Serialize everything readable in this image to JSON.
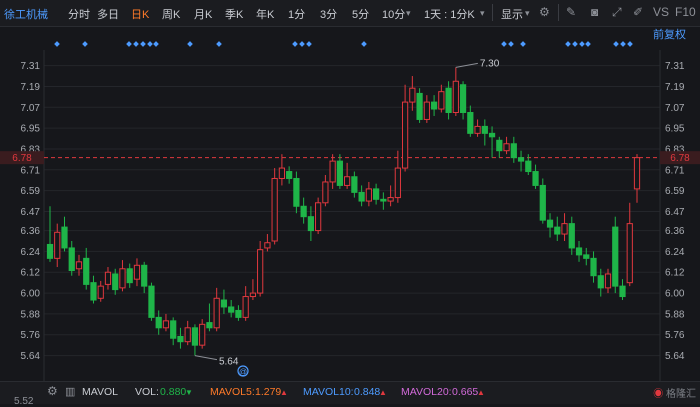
{
  "toolbar": {
    "stock_name": "徐工机械",
    "tabs": [
      "分时",
      "多日",
      "日K",
      "周K",
      "月K",
      "季K",
      "年K",
      "1分",
      "3分",
      "5分",
      "10分",
      "1天 : 1分K"
    ],
    "active_tab": "日K",
    "display_label": "显示",
    "vs_label": "VS",
    "f10_label": "F10"
  },
  "adjust_label": "前复权",
  "price_axis": {
    "left_ticks": [
      "7.31",
      "7.19",
      "7.07",
      "6.95",
      "6.83",
      "6.71",
      "6.59",
      "6.47",
      "6.36",
      "6.24",
      "6.12",
      "6.00",
      "5.88",
      "5.76",
      "5.64"
    ],
    "right_ticks": [
      "7.31",
      "7.19",
      "7.07",
      "6.95",
      "6.83",
      "6.71",
      "6.59",
      "6.47",
      "6.36",
      "6.24",
      "6.12",
      "6.00",
      "5.88",
      "5.76",
      "5.64"
    ],
    "current_price": "6.78",
    "bottom_partial_label": "5.52"
  },
  "annotations": {
    "high": "7.30",
    "low": "5.64",
    "at_marker": "@"
  },
  "volume_bar": {
    "mavol_label": "MAVOL",
    "vol_label": "VOL:",
    "vol_value": "0.880",
    "vol_arrow": "▼",
    "mavol5_label": "MAVOL5:",
    "mavol5_value": "1.279",
    "mavol5_arrow": "▲",
    "mavol10_label": "MAVOL10:",
    "mavol10_value": "0.848",
    "mavol10_arrow": "▲",
    "mavol20_label": "MAVOL20:",
    "mavol20_value": "0.665",
    "mavol20_arrow": "▲"
  },
  "watermark": "格隆汇",
  "colors": {
    "up": "#e0383e",
    "down": "#1fb549",
    "accent": "#4d9bff",
    "active_tab": "#ff7a29",
    "price_line": "#e0383e",
    "mavol5": "#ff7a29",
    "mavol10": "#4d9bff",
    "mavol20": "#d26ad9"
  },
  "chart_data": {
    "type": "candlestick",
    "y_range": [
      5.58,
      7.4
    ],
    "candles": [
      {
        "o": 6.28,
        "c": 6.2,
        "h": 6.5,
        "l": 6.18
      },
      {
        "o": 6.2,
        "c": 6.35,
        "h": 6.4,
        "l": 6.15
      },
      {
        "o": 6.38,
        "c": 6.26,
        "h": 6.44,
        "l": 6.24
      },
      {
        "o": 6.26,
        "c": 6.13,
        "h": 6.3,
        "l": 6.1
      },
      {
        "o": 6.14,
        "c": 6.18,
        "h": 6.22,
        "l": 6.1
      },
      {
        "o": 6.2,
        "c": 6.05,
        "h": 6.26,
        "l": 6.02
      },
      {
        "o": 6.06,
        "c": 5.96,
        "h": 6.1,
        "l": 5.94
      },
      {
        "o": 5.97,
        "c": 6.04,
        "h": 6.07,
        "l": 5.95
      },
      {
        "o": 6.05,
        "c": 6.12,
        "h": 6.15,
        "l": 6.02
      },
      {
        "o": 6.11,
        "c": 6.02,
        "h": 6.14,
        "l": 5.99
      },
      {
        "o": 6.03,
        "c": 6.14,
        "h": 6.19,
        "l": 6.01
      },
      {
        "o": 6.14,
        "c": 6.06,
        "h": 6.17,
        "l": 6.03
      },
      {
        "o": 6.08,
        "c": 6.16,
        "h": 6.2,
        "l": 6.04
      },
      {
        "o": 6.16,
        "c": 6.04,
        "h": 6.18,
        "l": 6.0
      },
      {
        "o": 6.04,
        "c": 5.86,
        "h": 6.06,
        "l": 5.84
      },
      {
        "o": 5.86,
        "c": 5.8,
        "h": 5.9,
        "l": 5.76
      },
      {
        "o": 5.8,
        "c": 5.84,
        "h": 5.88,
        "l": 5.78
      },
      {
        "o": 5.84,
        "c": 5.74,
        "h": 5.86,
        "l": 5.7
      },
      {
        "o": 5.75,
        "c": 5.72,
        "h": 5.8,
        "l": 5.68
      },
      {
        "o": 5.72,
        "c": 5.8,
        "h": 5.84,
        "l": 5.7
      },
      {
        "o": 5.8,
        "c": 5.7,
        "h": 5.82,
        "l": 5.64
      },
      {
        "o": 5.7,
        "c": 5.82,
        "h": 5.85,
        "l": 5.68
      },
      {
        "o": 5.83,
        "c": 5.8,
        "h": 5.94,
        "l": 5.78
      },
      {
        "o": 5.8,
        "c": 5.97,
        "h": 6.03,
        "l": 5.78
      },
      {
        "o": 5.96,
        "c": 5.92,
        "h": 6.02,
        "l": 5.88
      },
      {
        "o": 5.92,
        "c": 5.89,
        "h": 5.96,
        "l": 5.86
      },
      {
        "o": 5.9,
        "c": 5.86,
        "h": 5.93,
        "l": 5.84
      },
      {
        "o": 5.86,
        "c": 5.98,
        "h": 6.04,
        "l": 5.84
      },
      {
        "o": 5.98,
        "c": 6.0,
        "h": 6.08,
        "l": 5.96
      },
      {
        "o": 6.0,
        "c": 6.25,
        "h": 6.3,
        "l": 5.98
      },
      {
        "o": 6.26,
        "c": 6.29,
        "h": 6.34,
        "l": 6.24
      },
      {
        "o": 6.3,
        "c": 6.66,
        "h": 6.72,
        "l": 6.28
      },
      {
        "o": 6.66,
        "c": 6.72,
        "h": 6.8,
        "l": 6.62
      },
      {
        "o": 6.7,
        "c": 6.66,
        "h": 6.73,
        "l": 6.63
      },
      {
        "o": 6.66,
        "c": 6.5,
        "h": 6.7,
        "l": 6.46
      },
      {
        "o": 6.5,
        "c": 6.44,
        "h": 6.55,
        "l": 6.4
      },
      {
        "o": 6.44,
        "c": 6.36,
        "h": 6.5,
        "l": 6.3
      },
      {
        "o": 6.36,
        "c": 6.52,
        "h": 6.55,
        "l": 6.34
      },
      {
        "o": 6.52,
        "c": 6.64,
        "h": 6.68,
        "l": 6.5
      },
      {
        "o": 6.64,
        "c": 6.76,
        "h": 6.8,
        "l": 6.6
      },
      {
        "o": 6.76,
        "c": 6.62,
        "h": 6.8,
        "l": 6.6
      },
      {
        "o": 6.62,
        "c": 6.67,
        "h": 6.75,
        "l": 6.6
      },
      {
        "o": 6.67,
        "c": 6.58,
        "h": 6.7,
        "l": 6.55
      },
      {
        "o": 6.58,
        "c": 6.53,
        "h": 6.62,
        "l": 6.5
      },
      {
        "o": 6.53,
        "c": 6.6,
        "h": 6.64,
        "l": 6.5
      },
      {
        "o": 6.6,
        "c": 6.54,
        "h": 6.63,
        "l": 6.51
      },
      {
        "o": 6.54,
        "c": 6.53,
        "h": 6.58,
        "l": 6.48
      },
      {
        "o": 6.53,
        "c": 6.55,
        "h": 6.62,
        "l": 6.5
      },
      {
        "o": 6.55,
        "c": 6.72,
        "h": 6.82,
        "l": 6.52
      },
      {
        "o": 6.72,
        "c": 7.1,
        "h": 7.2,
        "l": 6.7
      },
      {
        "o": 7.1,
        "c": 7.18,
        "h": 7.25,
        "l": 7.05
      },
      {
        "o": 7.15,
        "c": 7.0,
        "h": 7.18,
        "l": 6.98
      },
      {
        "o": 7.0,
        "c": 7.1,
        "h": 7.14,
        "l": 6.98
      },
      {
        "o": 7.1,
        "c": 7.06,
        "h": 7.14,
        "l": 7.02
      },
      {
        "o": 7.06,
        "c": 7.16,
        "h": 7.2,
        "l": 7.04
      },
      {
        "o": 7.18,
        "c": 7.04,
        "h": 7.22,
        "l": 7.0
      },
      {
        "o": 7.04,
        "c": 7.22,
        "h": 7.3,
        "l": 7.02
      },
      {
        "o": 7.2,
        "c": 7.04,
        "h": 7.22,
        "l": 7.0
      },
      {
        "o": 7.04,
        "c": 6.92,
        "h": 7.08,
        "l": 6.9
      },
      {
        "o": 6.92,
        "c": 6.96,
        "h": 7.0,
        "l": 6.9
      },
      {
        "o": 6.96,
        "c": 6.92,
        "h": 7.0,
        "l": 6.85
      },
      {
        "o": 6.92,
        "c": 6.9,
        "h": 6.96,
        "l": 6.78
      },
      {
        "o": 6.88,
        "c": 6.82,
        "h": 6.9,
        "l": 6.78
      },
      {
        "o": 6.82,
        "c": 6.86,
        "h": 6.9,
        "l": 6.8
      },
      {
        "o": 6.86,
        "c": 6.78,
        "h": 6.9,
        "l": 6.75
      },
      {
        "o": 6.78,
        "c": 6.76,
        "h": 6.82,
        "l": 6.7
      },
      {
        "o": 6.76,
        "c": 6.7,
        "h": 6.8,
        "l": 6.68
      },
      {
        "o": 6.7,
        "c": 6.62,
        "h": 6.74,
        "l": 6.6
      },
      {
        "o": 6.62,
        "c": 6.42,
        "h": 6.66,
        "l": 6.4
      },
      {
        "o": 6.42,
        "c": 6.38,
        "h": 6.46,
        "l": 6.32
      },
      {
        "o": 6.38,
        "c": 6.34,
        "h": 6.44,
        "l": 6.3
      },
      {
        "o": 6.34,
        "c": 6.4,
        "h": 6.46,
        "l": 6.3
      },
      {
        "o": 6.4,
        "c": 6.26,
        "h": 6.44,
        "l": 6.22
      },
      {
        "o": 6.26,
        "c": 6.22,
        "h": 6.3,
        "l": 6.18
      },
      {
        "o": 6.22,
        "c": 6.2,
        "h": 6.26,
        "l": 6.16
      },
      {
        "o": 6.2,
        "c": 6.1,
        "h": 6.24,
        "l": 6.06
      },
      {
        "o": 6.1,
        "c": 6.03,
        "h": 6.14,
        "l": 5.98
      },
      {
        "o": 6.03,
        "c": 6.11,
        "h": 6.14,
        "l": 6.0
      },
      {
        "o": 6.38,
        "c": 6.04,
        "h": 6.44,
        "l": 6.0
      },
      {
        "o": 6.04,
        "c": 5.98,
        "h": 6.08,
        "l": 5.96
      },
      {
        "o": 6.06,
        "c": 6.4,
        "h": 6.52,
        "l": 6.04
      },
      {
        "o": 6.6,
        "c": 6.78,
        "h": 6.8,
        "l": 6.52
      }
    ]
  }
}
